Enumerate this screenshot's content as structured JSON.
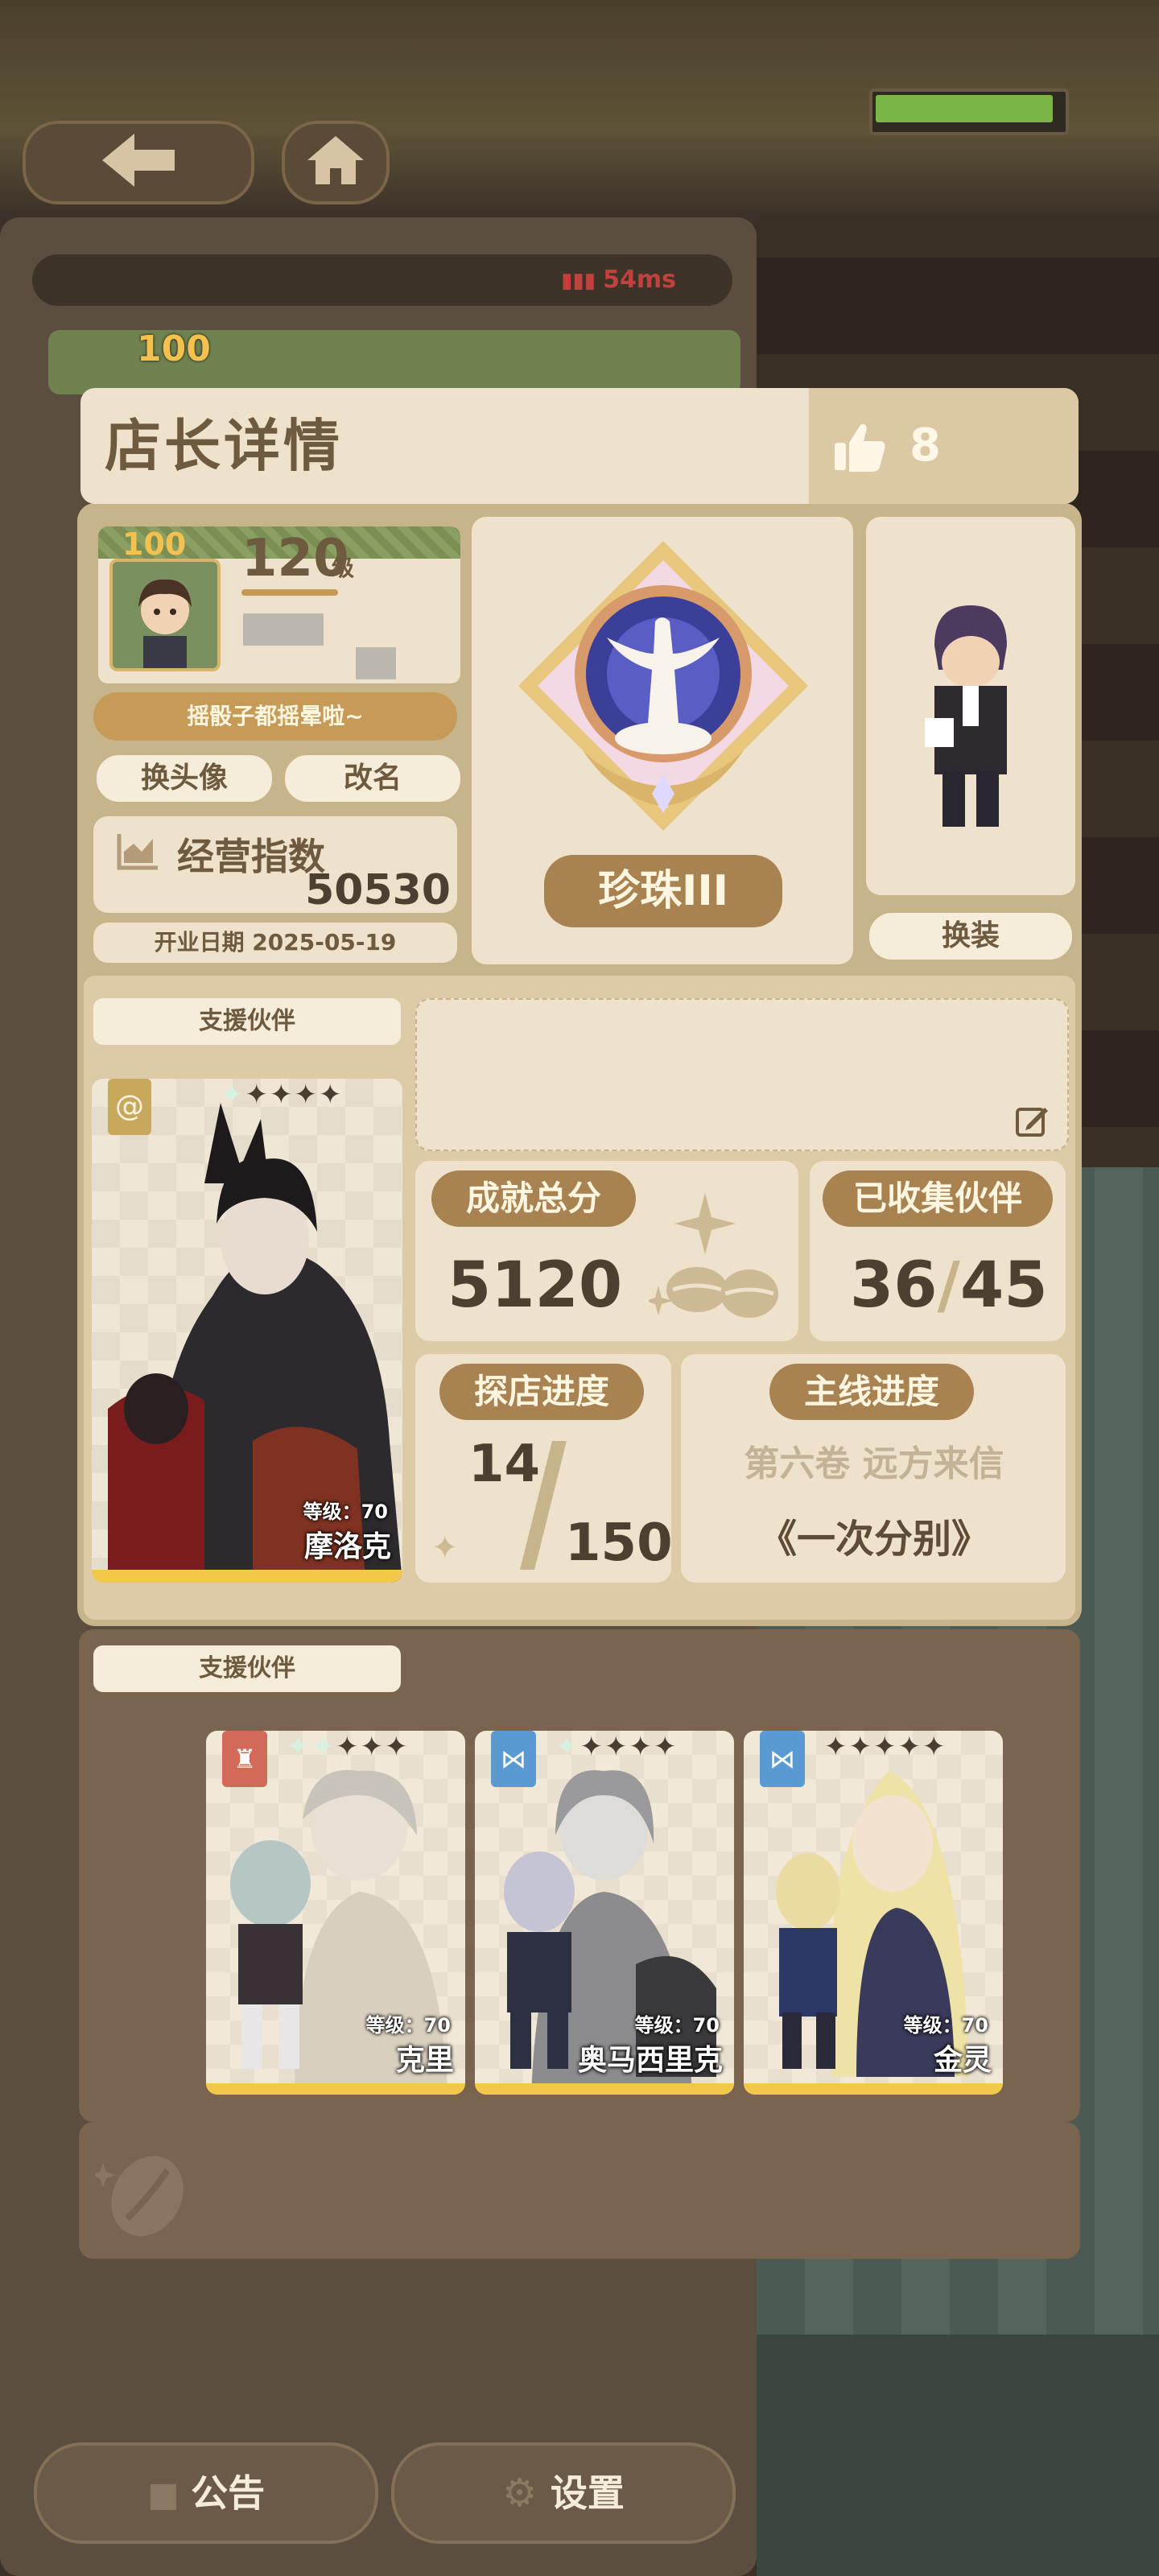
{
  "header": {
    "ping": "54ms",
    "shop_level_badge": "100"
  },
  "modal": {
    "title": "店长详情",
    "likes": "8",
    "player": {
      "avatar_badge": "100",
      "level": "120",
      "level_unit": "级",
      "signature": "摇骰子都摇晕啦~",
      "change_avatar": "换头像",
      "rename": "改名",
      "business_index_label": "经营指数",
      "business_index_value": "50530",
      "opening_date": "开业日期 2025-05-19"
    },
    "rank": {
      "name": "珍珠III"
    },
    "outfit": {
      "change_label": "换装"
    },
    "support": {
      "tab_label": "支援伙伴",
      "main_partner": {
        "level": "等级：70",
        "name": "摩洛克",
        "stars_lit": 1,
        "stars_total": 5
      }
    },
    "stats": {
      "achievement_label": "成就总分",
      "achievement_value": "5120",
      "collected_label": "已收集伙伴",
      "collected_current": "36",
      "collected_sep": "/",
      "collected_total": "45",
      "explore_label": "探店进度",
      "explore_current": "14",
      "explore_total": "150",
      "main_label": "主线进度",
      "main_volume": "第六卷 远方来信",
      "main_chapter": "《一次分别》"
    },
    "support2": {
      "tab_label": "支援伙伴",
      "partners": [
        {
          "level": "等级：70",
          "name": "克里",
          "tag_color": "#d26a5a",
          "stars_lit": 2
        },
        {
          "level": "等级：70",
          "name": "奥马西里克",
          "tag_color": "#5a9ad2",
          "stars_lit": 1
        },
        {
          "level": "等级：70",
          "name": "金灵",
          "tag_color": "#5a9ad2",
          "stars_lit": 0
        }
      ]
    }
  },
  "bottom": {
    "notice": "公告",
    "settings": "设置"
  },
  "colors": {
    "panel": "#eee2cc",
    "frame": "#c8b48a",
    "accent": "#a88251",
    "text": "#6e5a3f"
  }
}
